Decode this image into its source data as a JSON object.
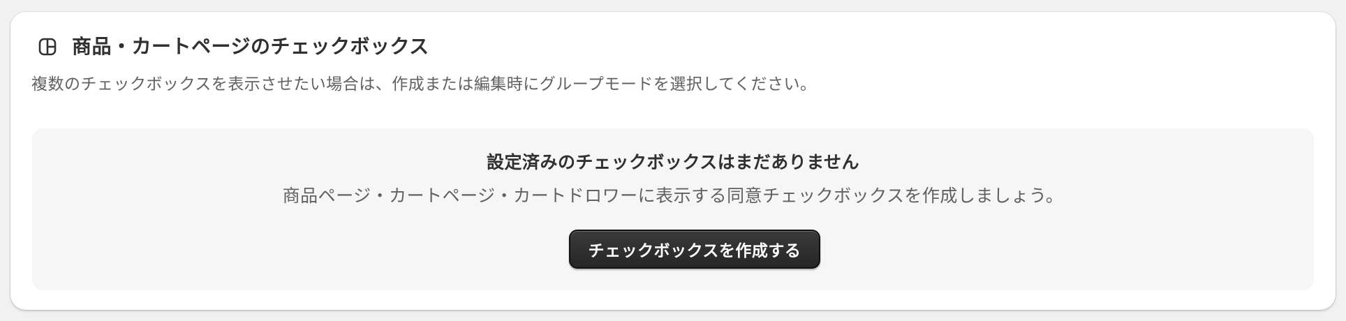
{
  "card": {
    "title": "商品・カートページのチェックボックス",
    "title_icon": "layout-blocks-icon",
    "description": "複数のチェックボックスを表示させたい場合は、作成または編集時にグループモードを選択してください。"
  },
  "empty_state": {
    "heading": "設定済みのチェックボックスはまだありません",
    "body": "商品ページ・カートページ・カートドロワーに表示する同意チェックボックスを作成しましょう。",
    "button_label": "チェックボックスを作成する"
  },
  "colors": {
    "page_background": "#f1f1f1",
    "card_background": "#ffffff",
    "empty_state_background": "#f6f6f6",
    "button_background": "#303030",
    "primary_text": "#303030",
    "secondary_text": "#616161"
  }
}
